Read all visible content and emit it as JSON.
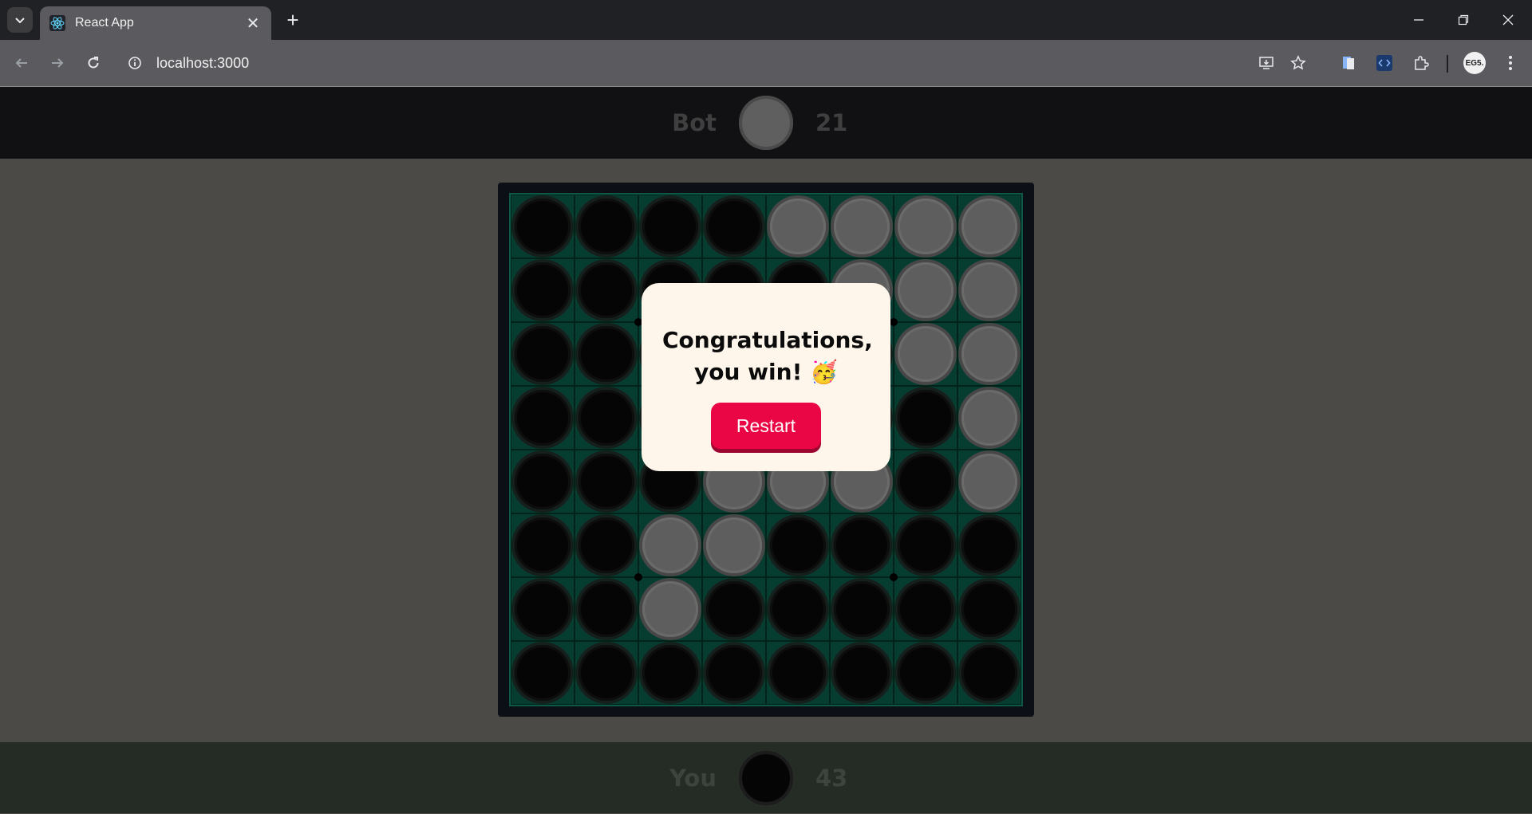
{
  "browser": {
    "tab_title": "React App",
    "url": "localhost:3000",
    "profile_label": "EG5.",
    "icons": [
      "tab-search-icon",
      "react-icon",
      "close-icon",
      "plus-icon",
      "minimize-icon",
      "restore-icon",
      "close-window-icon",
      "back-icon",
      "forward-icon",
      "reload-icon",
      "info-icon",
      "install-icon",
      "star-icon",
      "sidepanel-icon",
      "devtools-icon",
      "extensions-icon",
      "menu-icon"
    ]
  },
  "game": {
    "top_player": {
      "name": "Bot",
      "score": "21",
      "color": "white"
    },
    "bottom_player": {
      "name": "You",
      "score": "43",
      "color": "black"
    },
    "board": [
      "bbbbwwww",
      "bbbbbwww",
      "bbbbbbww",
      "bbbbbbbw",
      "bbbwwwbw",
      "bbwwbbbb",
      "bbwbbbbb",
      "bbbbbbbb"
    ],
    "colors": {
      "board": "#073d30",
      "restart": "#ea0644",
      "modal": "#fef6ea"
    }
  },
  "modal": {
    "message_line1": "Congratulations,",
    "message_line2": "you win! 🥳",
    "restart_label": "Restart"
  }
}
